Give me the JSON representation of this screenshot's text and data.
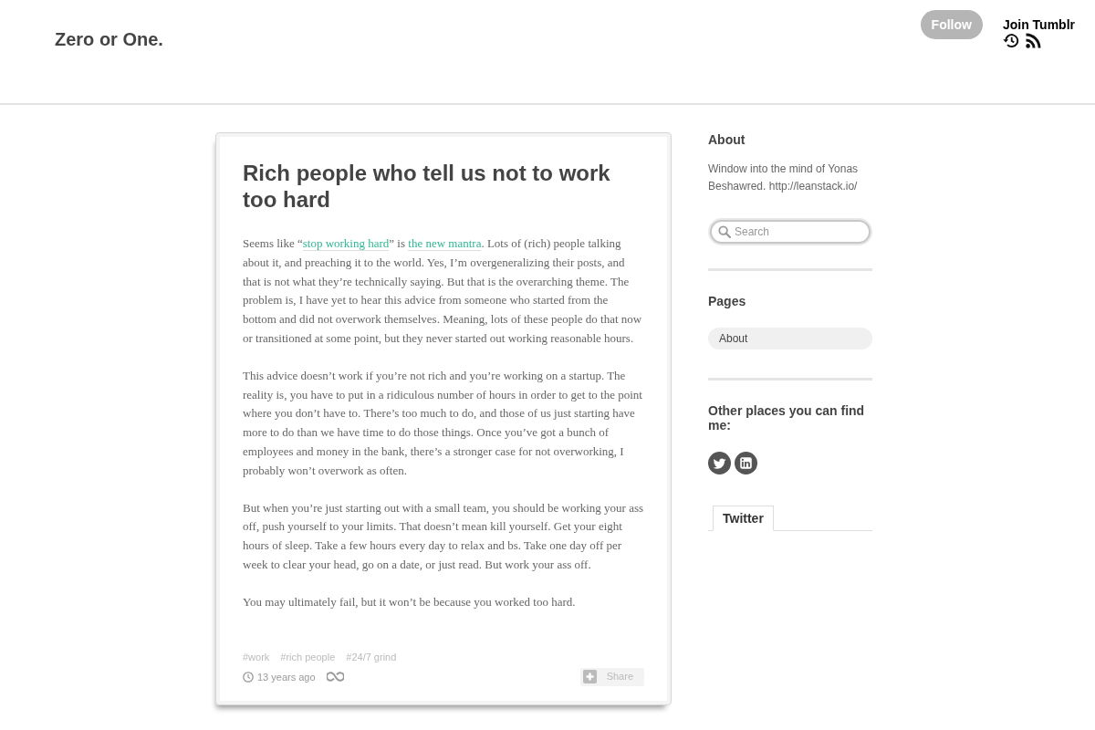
{
  "blog": {
    "title": "Zero or One."
  },
  "top_bar": {
    "follow_button": "Follow",
    "join_link": "Join Tumblr"
  },
  "post": {
    "title": "Rich people who tell us not to work too hard",
    "paragraphs": [
      {
        "parts": [
          {
            "kind": "text",
            "text": "Seems like “"
          },
          {
            "kind": "link",
            "text": "stop working hard"
          },
          {
            "kind": "text",
            "text": "” is "
          },
          {
            "kind": "link",
            "text": "the new mantra"
          },
          {
            "kind": "text",
            "text": ". Lots of (rich) people talking about it, and preaching it to the world. Yes, I’m overgeneralizing their posts, and that is not what they’re technically saying. But that is the overarching theme. The problem is, I have yet to hear this advice from someone who started from the bottom and did not overwork themselves. Meaning, lots of these people do that now or transitioned at some point, but they never started out working reasonable hours."
          }
        ]
      },
      {
        "parts": [
          {
            "kind": "text",
            "text": "This advice doesn’t work if you’re not rich and you’re working on a startup. The reality is, you have to put in a ridiculous number of hours in order to get to the point where you don’t have to. There’s too much to do, and those of us just starting have more to do than we have time to do those things. Once you’ve got a bunch of employees and money in the bank, there’s a stronger case for not overworking, I probably won’t overwork as often."
          }
        ]
      },
      {
        "parts": [
          {
            "kind": "text",
            "text": "But when you’re just starting out with a small team, you should be working your ass off, push yourself to your limits. That doesn’t mean kill yourself. Get your eight hours of sleep. Take a few hours every day to relax and bs. Take one day off per week to clear your head, go on a date, or just read. But work your ass off."
          }
        ]
      },
      {
        "parts": [
          {
            "kind": "text",
            "text": "You may ultimately fail, but it won’t be because you worked too hard."
          }
        ]
      }
    ],
    "tags": [
      "#work",
      "#rich people",
      "#24/7 grind"
    ],
    "timestamp": "13 years ago",
    "share_button": "Share"
  },
  "sidebar": {
    "about": {
      "heading": "About",
      "text": "Window into the mind of Yonas Beshawred. http://leanstack.io/"
    },
    "search": {
      "placeholder": "Search"
    },
    "pages": {
      "heading": "Pages",
      "items": [
        {
          "label": "About"
        }
      ]
    },
    "social": {
      "heading": "Other places you can find me:"
    },
    "tabs": [
      {
        "label": "Twitter",
        "selected": true
      }
    ]
  }
}
